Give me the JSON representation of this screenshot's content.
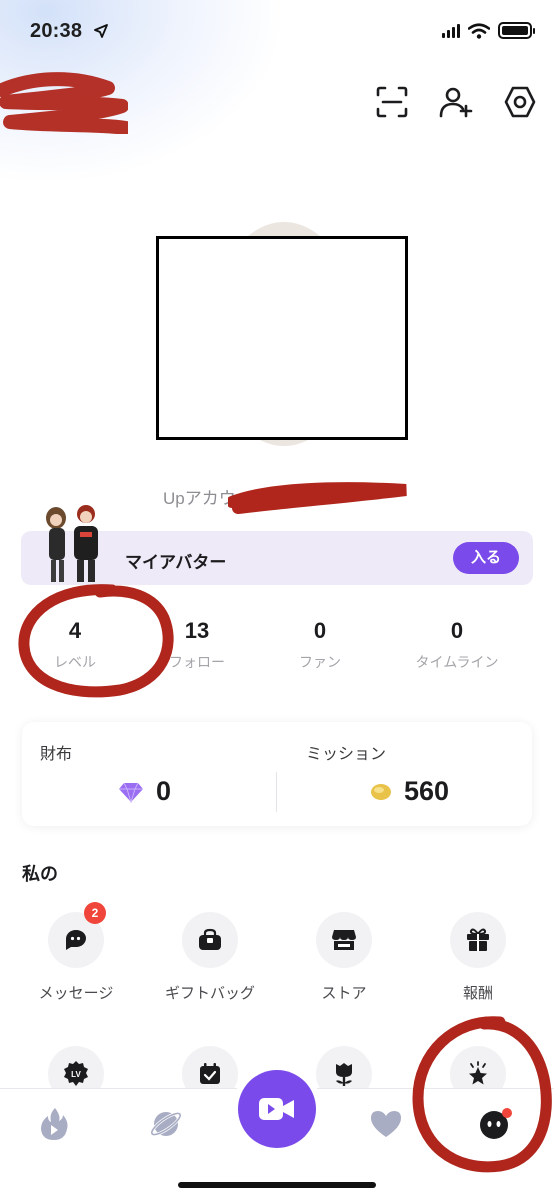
{
  "status_bar": {
    "time": "20:38"
  },
  "profile": {
    "account_label": "Upアカウ"
  },
  "banner": {
    "title": "マイアバター",
    "button": "入る"
  },
  "stats": [
    {
      "value": "4",
      "label": "レベル"
    },
    {
      "value": "13",
      "label": "フォロー"
    },
    {
      "value": "0",
      "label": "ファン"
    },
    {
      "value": "0",
      "label": "タイムライン"
    }
  ],
  "wallet": {
    "wallet_label": "財布",
    "wallet_value": "0",
    "mission_label": "ミッション",
    "mission_value": "560"
  },
  "section": {
    "title": "私の"
  },
  "menu": [
    {
      "label": "メッセージ",
      "icon": "chat-bubble-icon",
      "badge": "2"
    },
    {
      "label": "ギフトバッグ",
      "icon": "gift-bag-icon"
    },
    {
      "label": "ストア",
      "icon": "store-icon"
    },
    {
      "label": "報酬",
      "icon": "gift-icon"
    },
    {
      "label": "",
      "icon": "level-icon"
    },
    {
      "label": "",
      "icon": "calendar-check-icon"
    },
    {
      "label": "",
      "icon": "flower-icon"
    },
    {
      "label": "",
      "icon": "star-icon"
    }
  ],
  "colors": {
    "accent": "#7a4bea",
    "badge": "#f0453a",
    "tab_inactive": "#a9adc4",
    "annotation_red": "#b0261c"
  },
  "tabbar": [
    {
      "icon": "flame-icon"
    },
    {
      "icon": "planet-icon"
    },
    {
      "icon": "video-camera-icon"
    },
    {
      "icon": "heart-icon"
    },
    {
      "icon": "profile-face-icon"
    }
  ]
}
